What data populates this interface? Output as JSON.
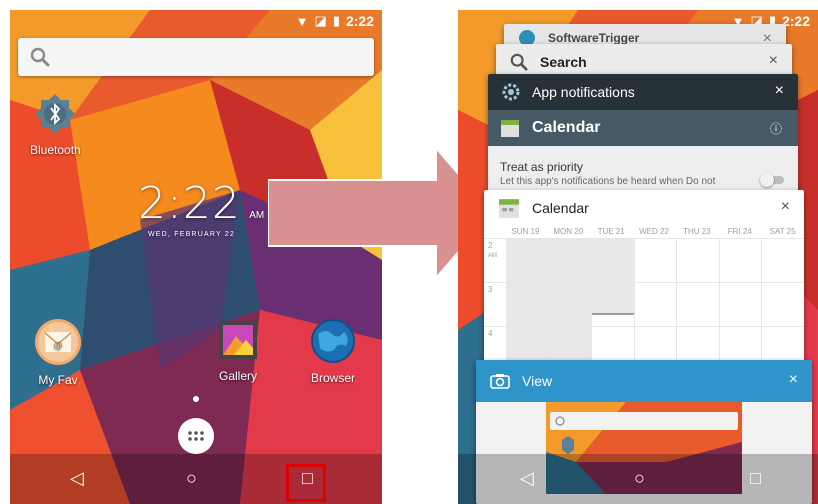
{
  "left_screen": {
    "status": {
      "time": "2:22"
    },
    "search": {
      "placeholder": ""
    },
    "apps": {
      "bluetooth": "Bluetooth",
      "my_fav": "My Fav",
      "gallery": "Gallery",
      "browser": "Browser"
    },
    "clock": {
      "time": "2:22",
      "ampm": "AM",
      "date": "WED, FEBRUARY 22"
    },
    "nav": {
      "back": "◁",
      "home": "○",
      "recents": "□"
    }
  },
  "right_screen": {
    "status": {
      "time": "2:22"
    },
    "cards": {
      "software_trigger": {
        "title": "SoftwareTrigger"
      },
      "search": {
        "title": "Search"
      },
      "app_notifications": {
        "title": "App notifications",
        "app_title": "Calendar",
        "pref_title": "Treat as priority",
        "pref_summary": "Let this app's notifications be heard when Do not"
      },
      "calendar": {
        "title": "Calendar",
        "days": [
          "SUN 19",
          "MON 20",
          "TUE 21",
          "WED 22",
          "THU 23",
          "FRI 24",
          "SAT 25"
        ],
        "hours": [
          "2",
          "3",
          "4"
        ],
        "hour_suffix": "AM"
      },
      "view": {
        "title": "View"
      }
    },
    "nav": {
      "back": "◁",
      "home": "○",
      "recents": "□"
    },
    "close_symbol": "×"
  },
  "colors": {
    "view_header": "#2f94c9",
    "app_notif_header": "#263238",
    "app_notif_subheader": "#455a64",
    "highlight": "#e00000",
    "arrow_fill": "#d99191"
  }
}
